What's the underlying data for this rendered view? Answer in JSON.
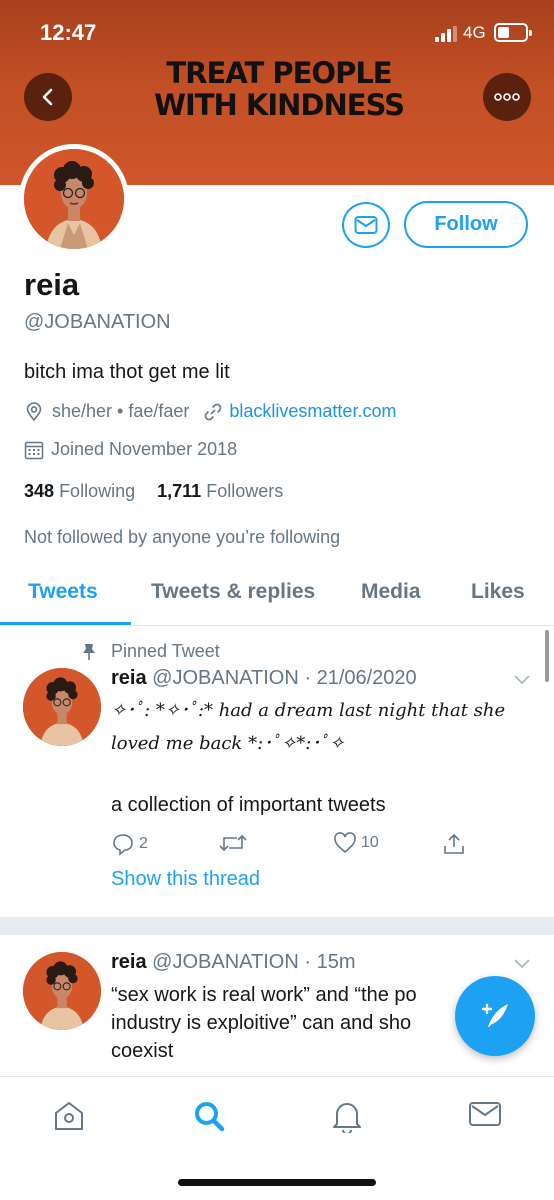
{
  "status": {
    "time": "12:47",
    "network": "4G"
  },
  "banner": {
    "line1": "TREAT PEOPLE",
    "line2": "WITH KINDNESS"
  },
  "profile": {
    "follow_label": "Follow",
    "name": "reia",
    "handle": "@JOBANATION",
    "bio": "bitch ima thot get me lit",
    "pronouns": "she/her • fae/faer",
    "website": "blacklivesmatter.com",
    "joined": "Joined November 2018",
    "following_count": "348",
    "following_label": "Following",
    "followers_count": "1,711",
    "followers_label": "Followers",
    "not_followed": "Not followed by anyone you’re following"
  },
  "tabs": [
    "Tweets",
    "Tweets & replies",
    "Media",
    "Likes"
  ],
  "tweets": [
    {
      "pinned_label": "Pinned Tweet",
      "name": "reia",
      "handle": "@JOBANATION",
      "time": "21/06/2020",
      "text_line1": "✧･ﾟ: *✧･ﾟ:* had a dream last night that she",
      "text_line2": "loved me back *:･ﾟ✧*:･ﾟ✧",
      "text_line3": "a collection of important tweets",
      "replies": "2",
      "likes": "10",
      "thread_link": "Show this thread"
    },
    {
      "name": "reia",
      "handle": "@JOBANATION",
      "time": "15m",
      "text_line1": "“sex work is real work” and “the po",
      "text_line2": "industry is exploitive” can and sho",
      "text_line3": "coexist"
    }
  ],
  "icons": {
    "back": "chevron-left-icon",
    "more": "more-icon",
    "message": "envelope-icon",
    "location": "location-pin-icon",
    "link": "link-icon",
    "calendar": "calendar-icon",
    "pin": "pin-icon",
    "reply": "reply-icon",
    "retweet": "retweet-icon",
    "like": "heart-icon",
    "share": "share-icon",
    "compose": "compose-icon",
    "nav": [
      "home-icon",
      "search-icon",
      "notifications-icon",
      "messages-icon"
    ]
  },
  "colors": {
    "accent": "#1da1f2",
    "banner": "#c24f25",
    "muted": "#657786"
  }
}
